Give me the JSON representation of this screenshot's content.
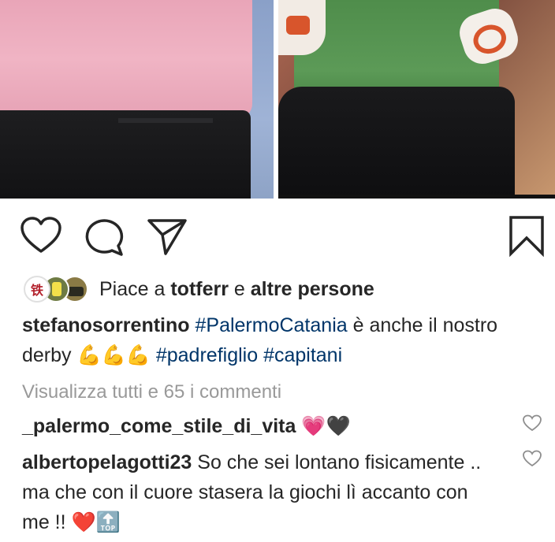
{
  "post": {
    "likes": {
      "prefix": "Piace a",
      "first_user": "totferr",
      "connector": "e",
      "others": "altre persone",
      "avatar1_char": "铁"
    },
    "caption": {
      "username": "stefanosorrentino",
      "hashtag1": "#PalermoCatania",
      "text1": "è anche il nostro derby",
      "emojis": "💪💪💪",
      "hashtag2": "#padrefiglio",
      "hashtag3": "#capitani"
    },
    "view_all_comments": "Visualizza tutti e 65 i commenti",
    "comments": [
      {
        "username": "_palermo_come_stile_di_vita",
        "text": "",
        "emojis": "💗🖤"
      },
      {
        "username": "albertopelagotti23",
        "text": "So che sei lontano fisicamente .. ma che con il cuore stasera la giochi lì accanto con me !!",
        "emojis": "❤️🔝"
      }
    ]
  },
  "icons": {
    "like": "heart-outline-icon",
    "comment": "comment-bubble-icon",
    "share": "send-paper-plane-icon",
    "save": "bookmark-icon",
    "comment_like": "small-heart-icon"
  },
  "colors": {
    "hashtag": "#003569",
    "muted": "#999999",
    "text": "#262626"
  }
}
